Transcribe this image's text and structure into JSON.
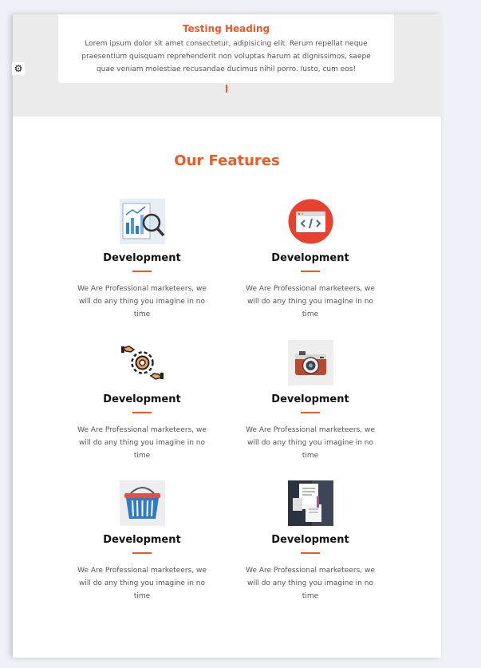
{
  "testimonial": {
    "heading": "Testing Heading",
    "text": "Lorem ipsum dolor sit amet consectetur, adipisicing elit. Rerum repellat neque praesentium quisquam reprehenderit non voluptas harum at dignissimos, saepe quae veniam molestiae recusandae ducimus nihil porro. Iusto, cum eos!"
  },
  "settings": {
    "icon": "gear-icon"
  },
  "features_section": {
    "title": "Our Features",
    "accent_color": "#ee5a24",
    "items": [
      {
        "icon": "analytics-magnifier-icon",
        "title": "Development",
        "description": "We Are Professional marketeers, we will do any thing you imagine in no time"
      },
      {
        "icon": "code-window-icon",
        "title": "Development",
        "description": "We Are Professional marketeers, we will do any thing you imagine in no time"
      },
      {
        "icon": "hands-gear-icon",
        "title": "Development",
        "description": "We Are Professional marketeers, we will do any thing you imagine in no time"
      },
      {
        "icon": "camera-icon",
        "title": "Development",
        "description": "We Are Professional marketeers, we will do any thing you imagine in no time"
      },
      {
        "icon": "shopping-basket-icon",
        "title": "Development",
        "description": "We Are Professional marketeers, we will do any thing you imagine in no time"
      },
      {
        "icon": "documents-icon",
        "title": "Development",
        "description": "We Are Professional marketeers, we will do any thing you imagine in no time"
      }
    ]
  }
}
